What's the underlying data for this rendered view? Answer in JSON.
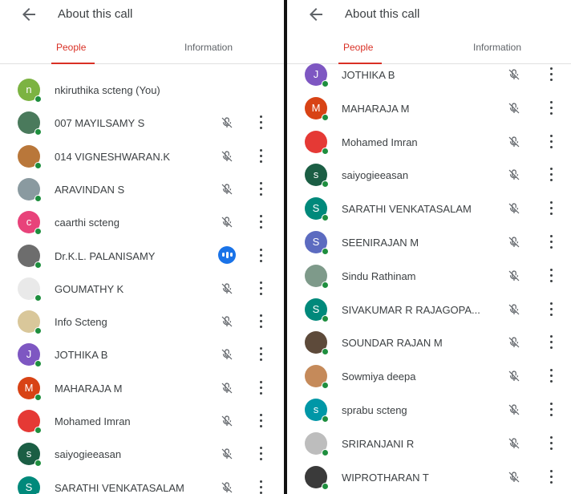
{
  "left": {
    "title": "About this call",
    "tabs": [
      {
        "label": "People"
      },
      {
        "label": "Information"
      }
    ],
    "participants": [
      {
        "name": "nkiruthika scteng (You)",
        "initial": "n",
        "color": "#7cb342",
        "mic": "none"
      },
      {
        "name": "007 MAYILSAMY S",
        "initial": "",
        "color": "#4a7a5c",
        "mic": "muted"
      },
      {
        "name": "014 VIGNESHWARAN.K",
        "initial": "",
        "color": "#b9773a",
        "mic": "muted"
      },
      {
        "name": "ARAVINDAN S",
        "initial": "",
        "color": "#8a9aa0",
        "mic": "muted"
      },
      {
        "name": "caarthi scteng",
        "initial": "c",
        "color": "#e8437a",
        "mic": "muted"
      },
      {
        "name": "Dr.K.L. PALANISAMY",
        "initial": "",
        "color": "#6d6d6d",
        "mic": "speaking"
      },
      {
        "name": "GOUMATHY K",
        "initial": "",
        "color": "#e9e9e9",
        "mic": "muted"
      },
      {
        "name": "Info Scteng",
        "initial": "",
        "color": "#d9c79a",
        "mic": "muted"
      },
      {
        "name": "JOTHIKA B",
        "initial": "J",
        "color": "#7e57c2",
        "mic": "muted"
      },
      {
        "name": "MAHARAJA M",
        "initial": "M",
        "color": "#d84315",
        "mic": "muted"
      },
      {
        "name": "Mohamed Imran",
        "initial": "",
        "color": "#e53935",
        "mic": "muted"
      },
      {
        "name": "saiyogieeasan",
        "initial": "s",
        "color": "#1b5e44",
        "mic": "muted"
      },
      {
        "name": "SARATHI VENKATASALAM",
        "initial": "S",
        "color": "#00897b",
        "mic": "muted"
      }
    ]
  },
  "right": {
    "title": "About this call",
    "tabs": [
      {
        "label": "People"
      },
      {
        "label": "Information"
      }
    ],
    "participants": [
      {
        "name": "JOTHIKA B",
        "initial": "J",
        "color": "#7e57c2",
        "mic": "muted"
      },
      {
        "name": "MAHARAJA M",
        "initial": "M",
        "color": "#d84315",
        "mic": "muted"
      },
      {
        "name": "Mohamed Imran",
        "initial": "",
        "color": "#e53935",
        "mic": "muted"
      },
      {
        "name": "saiyogieeasan",
        "initial": "s",
        "color": "#1b5e44",
        "mic": "muted"
      },
      {
        "name": "SARATHI VENKATASALAM",
        "initial": "S",
        "color": "#00897b",
        "mic": "muted"
      },
      {
        "name": "SEENIRAJAN M",
        "initial": "S",
        "color": "#5c6bc0",
        "mic": "muted"
      },
      {
        "name": "Sindu Rathinam",
        "initial": "",
        "color": "#7e9a8a",
        "mic": "muted"
      },
      {
        "name": "SIVAKUMAR R RAJAGOPA...",
        "initial": "S",
        "color": "#00897b",
        "mic": "muted"
      },
      {
        "name": "SOUNDAR RAJAN M",
        "initial": "",
        "color": "#5d4a3a",
        "mic": "muted"
      },
      {
        "name": "Sowmiya deepa",
        "initial": "",
        "color": "#c58a5a",
        "mic": "muted"
      },
      {
        "name": "sprabu scteng",
        "initial": "s",
        "color": "#0097a7",
        "mic": "muted"
      },
      {
        "name": "SRIRANJANI R",
        "initial": "",
        "color": "#bdbdbd",
        "mic": "muted"
      },
      {
        "name": "WIPROTHARAN T",
        "initial": "",
        "color": "#3a3a3a",
        "mic": "muted"
      }
    ]
  },
  "icons": {
    "back": "arrow-back-icon",
    "muted": "mic-off-icon",
    "speaking": "audio-levels-icon",
    "more": "more-vert-icon",
    "presence": "online-dot-icon"
  },
  "colors": {
    "accent": "#d93025",
    "online": "#1e8e3e",
    "speaking": "#1a73e8",
    "divider": "#111111"
  }
}
